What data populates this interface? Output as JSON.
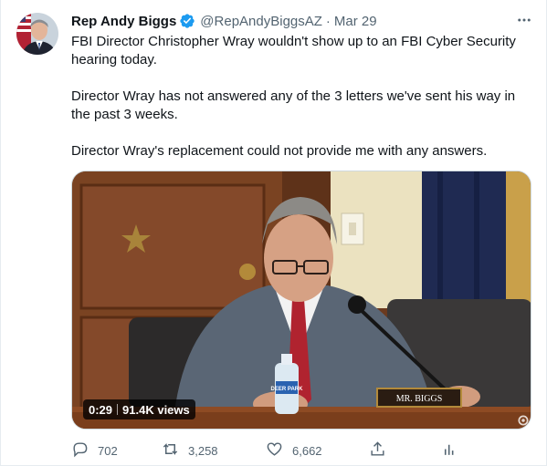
{
  "author": {
    "name": "Rep Andy Biggs",
    "handle": "@RepAndyBiggsAZ",
    "separator": "·",
    "date": "Mar 29"
  },
  "tweet": {
    "paragraphs": [
      "FBI Director Christopher Wray wouldn't show up to an FBI Cyber Security hearing today.",
      "Director Wray has not answered any of the 3 letters we've sent his way in the past 3 weeks.",
      "Director Wray's replacement could not provide me with any answers."
    ]
  },
  "video": {
    "duration": "0:29",
    "views": "91.4K views",
    "nameplate": "MR. BIGGS",
    "bottle_label": "DEER PARK"
  },
  "actions": {
    "replies": "702",
    "retweets": "3,258",
    "likes": "6,662"
  },
  "colors": {
    "accent": "#1d9bf0",
    "text": "#0f1419",
    "secondary": "#536471",
    "border": "#cfd9de"
  },
  "icons": {
    "verified": "verified-badge-icon",
    "more": "more-dots-icon",
    "reply": "reply-bubble-icon",
    "retweet": "retweet-arrows-icon",
    "like": "heart-icon",
    "share": "share-upload-icon",
    "analytics": "analytics-bars-icon"
  }
}
